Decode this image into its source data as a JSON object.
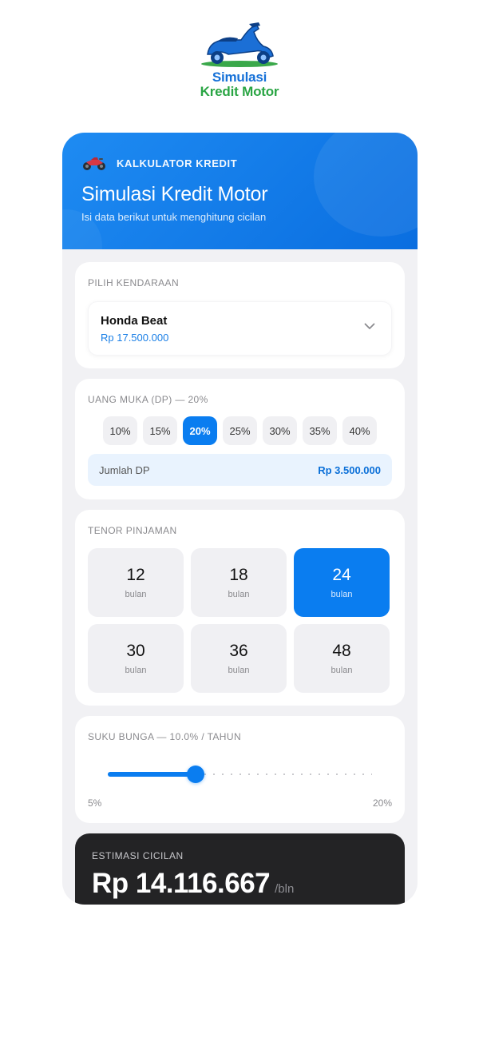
{
  "logo": {
    "line1": "Simulasi",
    "line2": "Kredit Motor",
    "icon": "scooter-icon"
  },
  "header": {
    "eyebrow": "KALKULATOR KREDIT",
    "title": "Simulasi Kredit Motor",
    "subtitle": "Isi data berikut untuk menghitung cicilan",
    "icon": "motorcycle-icon"
  },
  "vehicle": {
    "label": "PILIH KENDARAAN",
    "name": "Honda Beat",
    "price": "Rp 17.500.000"
  },
  "dp": {
    "label": "UANG MUKA (DP) — 20%",
    "options": [
      "10%",
      "15%",
      "20%",
      "25%",
      "30%",
      "35%",
      "40%"
    ],
    "selected": "20%",
    "total_label": "Jumlah DP",
    "total_value": "Rp 3.500.000"
  },
  "tenor": {
    "label": "TENOR PINJAMAN",
    "options": [
      {
        "value": "12",
        "unit": "bulan"
      },
      {
        "value": "18",
        "unit": "bulan"
      },
      {
        "value": "24",
        "unit": "bulan"
      },
      {
        "value": "30",
        "unit": "bulan"
      },
      {
        "value": "36",
        "unit": "bulan"
      },
      {
        "value": "48",
        "unit": "bulan"
      }
    ],
    "selected": "24"
  },
  "interest": {
    "label": "SUKU BUNGA — 10.0% / TAHUN",
    "min_label": "5%",
    "max_label": "20%",
    "min": 5,
    "max": 20,
    "value": 10.0
  },
  "result": {
    "label": "ESTIMASI CICILAN",
    "amount": "Rp 14.116.667",
    "per": "/bln"
  },
  "colors": {
    "accent": "#0a7df0",
    "header_gradient_start": "#1e8bf2",
    "logo_blue": "#1671d8",
    "logo_green": "#2aa544",
    "result_bg": "#232325"
  }
}
